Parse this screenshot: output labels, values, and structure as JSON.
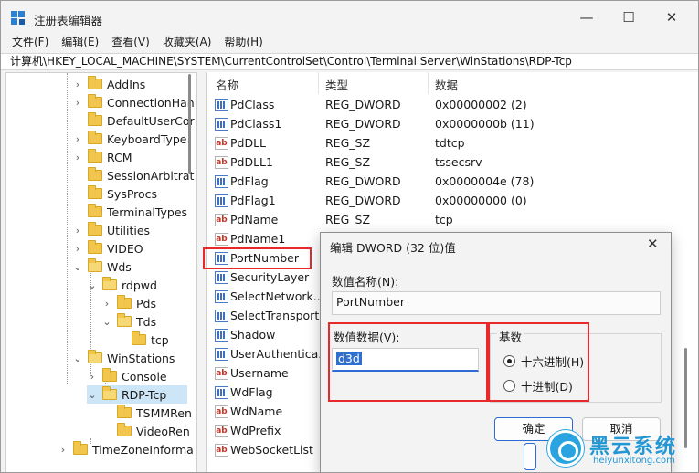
{
  "window": {
    "title": "注册表编辑器",
    "controls": {
      "minimize": "—",
      "maximize": "☐",
      "close": "✕"
    }
  },
  "menu": [
    "文件(F)",
    "编辑(E)",
    "查看(V)",
    "收藏夹(A)",
    "帮助(H)"
  ],
  "address": "计算机\\HKEY_LOCAL_MACHINE\\SYSTEM\\CurrentControlSet\\Control\\Terminal Server\\WinStations\\RDP-Tcp",
  "tree": {
    "items": [
      {
        "label": "AddIns",
        "chevron": "›",
        "selected": false
      },
      {
        "label": "ConnectionHan",
        "chevron": "›",
        "selected": false
      },
      {
        "label": "DefaultUserCor",
        "chevron": "",
        "selected": false
      },
      {
        "label": "KeyboardType",
        "chevron": "›",
        "selected": false
      },
      {
        "label": "RCM",
        "chevron": "›",
        "selected": false
      },
      {
        "label": "SessionArbitrat",
        "chevron": "",
        "selected": false
      },
      {
        "label": "SysProcs",
        "chevron": "",
        "selected": false
      },
      {
        "label": "TerminalTypes",
        "chevron": "",
        "selected": false
      },
      {
        "label": "Utilities",
        "chevron": "›",
        "selected": false
      },
      {
        "label": "VIDEO",
        "chevron": "›",
        "selected": false
      },
      {
        "label": "Wds",
        "chevron": "⌄",
        "selected": false
      },
      {
        "label": "rdpwd",
        "chevron": "⌄",
        "selected": false
      },
      {
        "label": "Pds",
        "chevron": "›",
        "selected": false
      },
      {
        "label": "Tds",
        "chevron": "⌄",
        "selected": false
      },
      {
        "label": "tcp",
        "chevron": "",
        "selected": false
      },
      {
        "label": "WinStations",
        "chevron": "⌄",
        "selected": false
      },
      {
        "label": "Console",
        "chevron": "›",
        "selected": false
      },
      {
        "label": "RDP-Tcp",
        "chevron": "⌄",
        "selected": true
      },
      {
        "label": "TSMMRen",
        "chevron": "",
        "selected": false
      },
      {
        "label": "VideoRen",
        "chevron": "",
        "selected": false
      },
      {
        "label": "TimeZoneInforma",
        "chevron": "›",
        "selected": false
      }
    ]
  },
  "list": {
    "headers": {
      "name": "名称",
      "type": "类型",
      "data": "数据"
    },
    "rows": [
      {
        "name": "PdClass",
        "type": "REG_DWORD",
        "data": "0x00000002 (2)",
        "icon": "dword-icon"
      },
      {
        "name": "PdClass1",
        "type": "REG_DWORD",
        "data": "0x0000000b (11)",
        "icon": "dword-icon"
      },
      {
        "name": "PdDLL",
        "type": "REG_SZ",
        "data": "tdtcp",
        "icon": "string-icon"
      },
      {
        "name": "PdDLL1",
        "type": "REG_SZ",
        "data": "tssecsrv",
        "icon": "string-icon"
      },
      {
        "name": "PdFlag",
        "type": "REG_DWORD",
        "data": "0x0000004e (78)",
        "icon": "dword-icon"
      },
      {
        "name": "PdFlag1",
        "type": "REG_DWORD",
        "data": "0x00000000 (0)",
        "icon": "dword-icon"
      },
      {
        "name": "PdName",
        "type": "REG_SZ",
        "data": "tcp",
        "icon": "string-icon"
      },
      {
        "name": "PdName1",
        "type": "",
        "data": "",
        "icon": "string-icon"
      },
      {
        "name": "PortNumber",
        "type": "",
        "data": "",
        "icon": "dword-icon"
      },
      {
        "name": "SecurityLayer",
        "type": "",
        "data": "",
        "icon": "dword-icon"
      },
      {
        "name": "SelectNetwork...",
        "type": "",
        "data": "",
        "icon": "dword-icon"
      },
      {
        "name": "SelectTransport",
        "type": "",
        "data": "",
        "icon": "dword-icon"
      },
      {
        "name": "Shadow",
        "type": "",
        "data": "",
        "icon": "dword-icon"
      },
      {
        "name": "UserAuthentica...",
        "type": "",
        "data": "",
        "icon": "dword-icon"
      },
      {
        "name": "Username",
        "type": "",
        "data": "",
        "icon": "string-icon"
      },
      {
        "name": "WdFlag",
        "type": "",
        "data": "",
        "icon": "dword-icon"
      },
      {
        "name": "WdName",
        "type": "",
        "data": "",
        "icon": "string-icon"
      },
      {
        "name": "WdPrefix",
        "type": "",
        "data": "",
        "icon": "string-icon"
      },
      {
        "name": "WebSocketList",
        "type": "",
        "data": "",
        "icon": "string-icon"
      }
    ]
  },
  "dialog": {
    "title": "编辑 DWORD (32 位)值",
    "close": "✕",
    "value_name_label": "数值名称(N):",
    "value_name": "PortNumber",
    "value_data_label": "数值数据(V):",
    "value_data": "d3d",
    "base_label": "基数",
    "radio_hex": "十六进制(H)",
    "radio_dec": "十进制(D)",
    "ok": "确定",
    "cancel": "取消"
  },
  "watermark": {
    "text": "黑云系统",
    "sub": "heiyunxitong.com"
  },
  "colors": {
    "highlight": "#e8282b",
    "selection": "#cde6f7",
    "accent": "#2d6ad3"
  }
}
